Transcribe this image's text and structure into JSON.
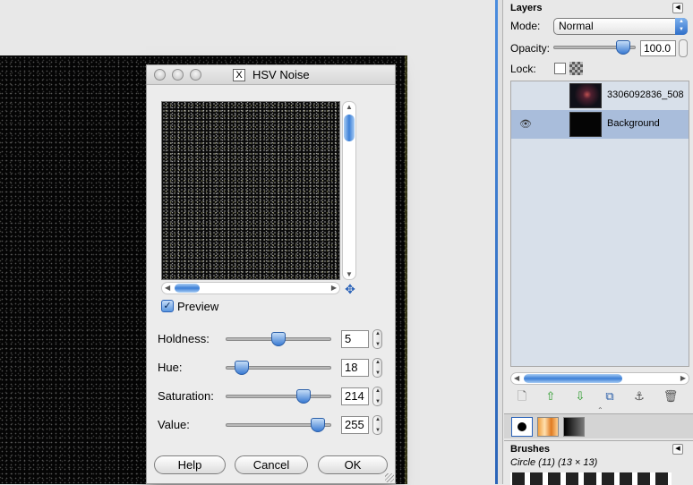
{
  "dialog": {
    "title": "HSV Noise",
    "title_icon": "X",
    "preview_label": "Preview",
    "preview_checked": true,
    "params": [
      {
        "label": "Holdness:",
        "value": "5",
        "level": 0.5
      },
      {
        "label": "Hue:",
        "value": "18",
        "level": 0.15
      },
      {
        "label": "Saturation:",
        "value": "214",
        "level": 0.74
      },
      {
        "label": "Value:",
        "value": "255",
        "level": 0.88
      }
    ],
    "buttons": {
      "help": "Help",
      "cancel": "Cancel",
      "ok": "OK"
    }
  },
  "layers": {
    "title": "Layers",
    "mode_label": "Mode:",
    "mode_value": "Normal",
    "opacity_label": "Opacity:",
    "opacity_value": "100.0",
    "lock_label": "Lock:",
    "items": [
      {
        "name": "3306092836_508",
        "visible": false,
        "selected": false
      },
      {
        "name": "Background",
        "visible": true,
        "selected": true
      }
    ]
  },
  "brushes": {
    "title": "Brushes",
    "current": "Circle (11) (13 × 13)"
  },
  "colors": {
    "selection": "#a9bddb",
    "accent": "#3a7ad2"
  },
  "icons": [
    "close-icon",
    "minimize-icon",
    "zoom-icon",
    "navigate-icon",
    "eye-icon",
    "new-layer-icon",
    "raise-icon",
    "lower-icon",
    "duplicate-icon",
    "anchor-icon",
    "delete-icon"
  ]
}
